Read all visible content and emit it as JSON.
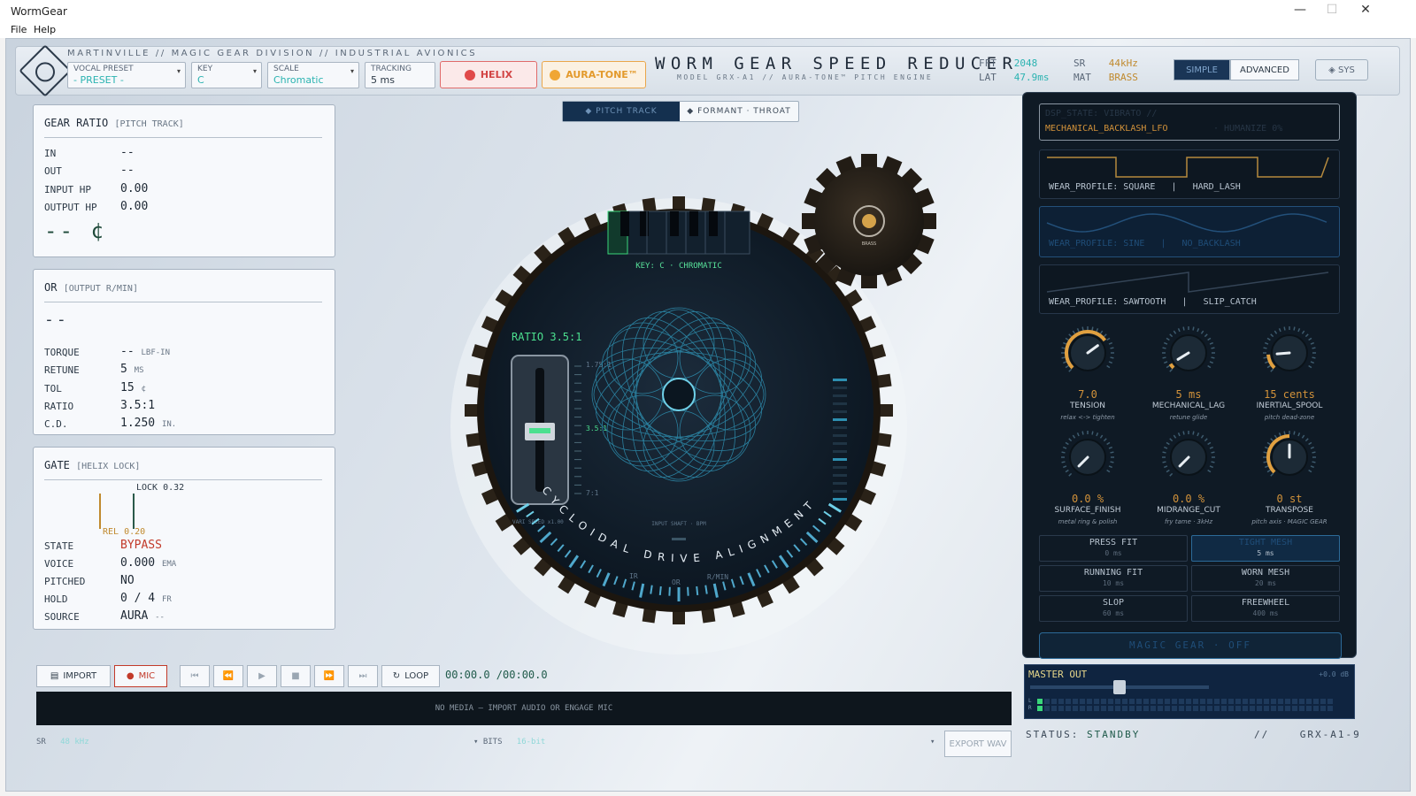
{
  "window": {
    "title": "WormGear",
    "minimize": "—",
    "maximize": "☐",
    "close": "✕"
  },
  "menu": {
    "file": "File",
    "help": "Help"
  },
  "header": {
    "breadcrumb": "MARTINVILLE // MAGIC GEAR DIVISION // INDUSTRIAL AVIONICS",
    "vocal_preset": {
      "label": "VOCAL PRESET",
      "value": "- PRESET -"
    },
    "key": {
      "label": "KEY",
      "value": "C"
    },
    "scale": {
      "label": "SCALE",
      "value": "Chromatic"
    },
    "tracking": {
      "label": "TRACKING",
      "value": "5 ms"
    },
    "helix": "HELIX",
    "auratone": "AURA-TONE™",
    "title": "WORM GEAR SPEED REDUCER",
    "subtitle": "MODEL GRX-A1 // AURA-TONE™ PITCH ENGINE",
    "fft_label": "FFT",
    "fft_value": "2048",
    "lat_label": "LAT",
    "lat_value": "47.9ms",
    "sr_label": "SR",
    "sr_value": "44kHz",
    "mat_label": "MAT",
    "mat_value": "BRASS",
    "simple": "SIMPLE",
    "advanced": "ADVANCED",
    "sys": "◈ SYS"
  },
  "gear_ratio": {
    "title": "GEAR RATIO",
    "tag": "[PITCH TRACK]",
    "rows": [
      {
        "label": "IN",
        "value": "--"
      },
      {
        "label": "OUT",
        "value": "--"
      },
      {
        "label": "INPUT HP",
        "value": "0.00"
      },
      {
        "label": "OUTPUT HP",
        "value": "0.00"
      }
    ],
    "big": "-- ¢"
  },
  "or_card": {
    "title": "OR",
    "tag": "[OUTPUT R/MIN]",
    "big": "--",
    "rows": [
      {
        "label": "TORQUE",
        "value": "--",
        "unit": "LBF-IN"
      },
      {
        "label": "RETUNE",
        "value": "5",
        "unit": "MS"
      },
      {
        "label": "TOL",
        "value": "15",
        "unit": "¢"
      },
      {
        "label": "RATIO",
        "value": "3.5:1",
        "unit": ""
      },
      {
        "label": "C.D.",
        "value": "1.250",
        "unit": "IN."
      }
    ]
  },
  "gate": {
    "title": "GATE",
    "tag": "[HELIX LOCK]",
    "lock": "LOCK 0.32",
    "rel": "REL 0.20",
    "rows": [
      {
        "label": "STATE",
        "value": "BYPASS",
        "unit": ""
      },
      {
        "label": "VOICE",
        "value": "0.000",
        "unit": "EMA"
      },
      {
        "label": "PITCHED",
        "value": "NO",
        "unit": ""
      },
      {
        "label": "HOLD",
        "value": "0 / 4",
        "unit": "FR"
      },
      {
        "label": "SOURCE",
        "value": "AURA",
        "unit": "--"
      }
    ]
  },
  "center": {
    "tab_pitch": "◆ PITCH TRACK",
    "tab_formant": "◆ FORMANT · THROAT",
    "key_readout": "KEY: C  ·  CHROMATIC",
    "ratio_label": "RATIO 3.5:1",
    "scale_top": "1.75:1",
    "scale_mid": "3.5:1",
    "scale_bot": "7:1",
    "arc_text": "CYCLOIDAL DRIVE ALIGNMENT",
    "input_shaft": "INPUT SHAFT · BPM",
    "ir": "IR",
    "or": "OR",
    "rmin": "R/MIN",
    "vari": "VARI SPEED x1.00",
    "small_gear": "BRASS"
  },
  "right": {
    "dsp_line1": "DSP_STATE: VIBRATO //",
    "dsp_line2": "MECHANICAL_BACKLASH_LFO",
    "dsp_humanize": "· HUMANIZE 0%",
    "profiles": [
      {
        "label": "WEAR_PROFILE: SQUARE",
        "sep": "|",
        "mode": "HARD_LASH"
      },
      {
        "label": "WEAR_PROFILE: SINE",
        "sep": "|",
        "mode": "NO_BACKLASH"
      },
      {
        "label": "WEAR_PROFILE: SAWTOOTH",
        "sep": "|",
        "mode": "SLIP_CATCH"
      }
    ],
    "knobs": [
      {
        "value": "7.0",
        "label": "TENSION",
        "hint": "relax <-> tighten",
        "fill": 0.7
      },
      {
        "value": "5 ms",
        "label": "MECHANICAL_LAG",
        "hint": "retune glide",
        "fill": 0.05
      },
      {
        "value": "15 cents",
        "label": "INERTIAL_SPOOL",
        "hint": "pitch dead-zone",
        "fill": 0.15
      },
      {
        "value": "0.0 %",
        "label": "SURFACE_FINISH",
        "hint": "metal ring & polish",
        "fill": 0.0
      },
      {
        "value": "0.0 %",
        "label": "MIDRANGE_CUT",
        "hint": "fry tame · 3kHz",
        "fill": 0.0
      },
      {
        "value": "0 st",
        "label": "TRANSPOSE",
        "hint": "pitch axis · MAGIC GEAR",
        "fill": 0.5
      }
    ],
    "fits": [
      {
        "name": "PRESS FIT",
        "val": "0 ms"
      },
      {
        "name": "TIGHT MESH",
        "val": "5 ms"
      },
      {
        "name": "RUNNING FIT",
        "val": "10 ms"
      },
      {
        "name": "WORN MESH",
        "val": "20 ms"
      },
      {
        "name": "SLOP",
        "val": "60 ms"
      },
      {
        "name": "FREEWHEEL",
        "val": "400 ms"
      }
    ],
    "magic": "MAGIC GEAR · OFF"
  },
  "transport": {
    "import": "IMPORT",
    "mic": "MIC",
    "loop": "LOOP",
    "time": "00:00.0 /00:00.0",
    "nomedia": "NO MEDIA — IMPORT AUDIO OR ENGAGE MIC",
    "sr_label": "SR",
    "sr_value": "48 kHz",
    "bits_label": "BITS",
    "bits_value": "16-bit",
    "export": "EXPORT WAV"
  },
  "master": {
    "label": "MASTER OUT",
    "db": "+0.0 dB",
    "level": 0.5,
    "l": "L",
    "r": "R"
  },
  "status": {
    "label": "STATUS:",
    "value": "STANDBY",
    "sep": "//",
    "id": "GRX-A1-9"
  },
  "colors": {
    "accent_teal": "#2bb3b1",
    "accent_amber": "#d2923a",
    "helix_red": "#e04a4a",
    "aura_amber": "#f0a634",
    "navy": "#1a3556"
  }
}
